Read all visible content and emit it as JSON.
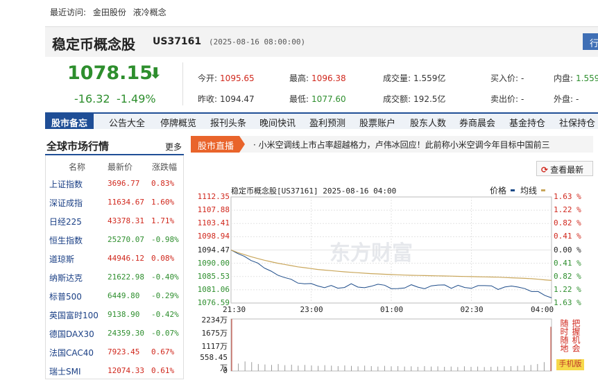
{
  "topbar": {
    "recent_label": "最近访问:",
    "recent_links": [
      "金田股份",
      "液冷概念"
    ]
  },
  "header": {
    "name": "稳定币概念股",
    "code": "US37161",
    "time": "(2025-08-16 08:00:00)",
    "trade_button": "行"
  },
  "quote": {
    "price": "1078.15",
    "arrow": "⬇",
    "change": "-16.32",
    "change_pct": "-1.49%",
    "open_label": "今开:",
    "open": "1095.65",
    "high_label": "最高:",
    "high": "1096.38",
    "volume_label": "成交量:",
    "volume": "1.559亿",
    "bid_label": "买入价:",
    "bid": "-",
    "inner_label": "内盘:",
    "inner": "1.559",
    "prev_label": "昨收:",
    "prev": "1094.47",
    "low_label": "最低:",
    "low": "1077.60",
    "amount_label": "成交额:",
    "amount": "192.5亿",
    "ask_label": "卖出价:",
    "ask": "-",
    "outer_label": "外盘:",
    "outer": "-"
  },
  "nav": {
    "active": "股市备忘",
    "items": [
      "公告大全",
      "停牌概览",
      "报刊头条",
      "晚间快讯",
      "盈利预测",
      "股票账户",
      "股东人数",
      "券商晨会",
      "基金持仓",
      "社保持仓"
    ]
  },
  "side": {
    "title": "全球市场行情",
    "more": "更多",
    "headers": [
      "名称",
      "最新价",
      "涨跌幅"
    ],
    "rows": [
      {
        "name": "上证指数",
        "price": "3696.77",
        "change": "0.83%",
        "dir": "up"
      },
      {
        "name": "深证成指",
        "price": "11634.67",
        "change": "1.60%",
        "dir": "up"
      },
      {
        "name": "日经225",
        "price": "43378.31",
        "change": "1.71%",
        "dir": "up"
      },
      {
        "name": "恒生指数",
        "price": "25270.07",
        "change": "-0.98%",
        "dir": "down"
      },
      {
        "name": "道琼斯",
        "price": "44946.12",
        "change": "0.08%",
        "dir": "up"
      },
      {
        "name": "纳斯达克",
        "price": "21622.98",
        "change": "-0.40%",
        "dir": "down"
      },
      {
        "name": "标普500",
        "price": "6449.80",
        "change": "-0.29%",
        "dir": "down"
      },
      {
        "name": "英国富时100",
        "price": "9138.90",
        "change": "-0.42%",
        "dir": "down"
      },
      {
        "name": "德国DAX30",
        "price": "24359.30",
        "change": "-0.07%",
        "dir": "down"
      },
      {
        "name": "法国CAC40",
        "price": "7923.45",
        "change": "0.67%",
        "dir": "up"
      },
      {
        "name": "瑞士SMI",
        "price": "12074.33",
        "change": "0.61%",
        "dir": "up"
      }
    ]
  },
  "live": {
    "tag": "股市直播",
    "news": "· 小米空调线上市占率超越格力，卢伟冰回应！此前称小米空调今年目标中国前三"
  },
  "refresh_label": "查看最新",
  "watermark": "东方财富",
  "mobile": {
    "lines": [
      "随时随地",
      "把握机会"
    ],
    "badge": "手机版"
  },
  "colors": {
    "up": "#d0271c",
    "down": "#2d8e2d",
    "price_line": "#1b4a88",
    "avg_line": "#c9a65a",
    "nav_active": "#1f4e96",
    "live_tag": "#e9642b"
  },
  "chart_data": {
    "type": "line",
    "title": "稳定币概念股[US37161] 2025-08-16 04:00",
    "legend": [
      "价格",
      "均线"
    ],
    "y_ticks": [
      "1112.35",
      "1107.88",
      "1103.41",
      "1098.94",
      "1094.47",
      "1090.00",
      "1085.53",
      "1081.06",
      "1076.59"
    ],
    "pct_ticks": [
      "1.63 %",
      "1.22 %",
      "0.82 %",
      "0.41 %",
      "0.00 %",
      "0.41 %",
      "0.82 %",
      "1.22 %",
      "1.63 %"
    ],
    "x_ticks": [
      "21:30",
      "23:00",
      "01:00",
      "02:30",
      "04:00"
    ],
    "ylim": [
      1076.59,
      1112.35
    ],
    "series": [
      {
        "name": "价格",
        "values": [
          1094.47,
          1093.4,
          1092.1,
          1091.2,
          1089.8,
          1088.6,
          1087.2,
          1086.0,
          1085.3,
          1084.4,
          1083.6,
          1082.8,
          1083.4,
          1082.2,
          1081.8,
          1082.6,
          1081.4,
          1082.1,
          1082.8,
          1082.2,
          1081.6,
          1082.3,
          1083.0,
          1082.4,
          1081.7,
          1081.2,
          1081.9,
          1082.6,
          1082.0,
          1081.5,
          1082.2,
          1082.9,
          1082.4,
          1081.8,
          1082.4,
          1081.9,
          1081.6,
          1082.3,
          1082.7,
          1082.1,
          1081.4,
          1081.8,
          1082.4,
          1082.0,
          1081.3,
          1080.7,
          1080.2,
          1079.4,
          1078.15
        ]
      },
      {
        "name": "均线",
        "values": [
          1094.47,
          1093.6,
          1092.9,
          1092.2,
          1091.6,
          1091.0,
          1090.5,
          1090.0,
          1089.6,
          1089.2,
          1088.8,
          1088.5,
          1088.2,
          1087.9,
          1087.7,
          1087.5,
          1087.3,
          1087.1,
          1086.95,
          1086.8,
          1086.65,
          1086.5,
          1086.4,
          1086.3,
          1086.2,
          1086.1,
          1086.0,
          1085.95,
          1085.9,
          1085.85,
          1085.8,
          1085.75,
          1085.7,
          1085.65,
          1085.6,
          1085.55,
          1085.5,
          1085.45,
          1085.4,
          1085.35,
          1085.3,
          1085.2,
          1085.1,
          1085.0,
          1084.9,
          1084.8,
          1084.6,
          1084.4,
          1084.2
        ]
      }
    ],
    "volume_ticks": [
      "2234万",
      "1675万",
      "1117万",
      "558.45万",
      "0"
    ],
    "volume_ylim": [
      0,
      2234
    ],
    "volume": [
      2234,
      320,
      410,
      380,
      300,
      280,
      260,
      300,
      250,
      270,
      230,
      260,
      240,
      220,
      250,
      230,
      210,
      240,
      220,
      200,
      230,
      210,
      190,
      220,
      200,
      210,
      190,
      200,
      180,
      210,
      190,
      200,
      180,
      190,
      170,
      200,
      180,
      190,
      170,
      180,
      190,
      200,
      210,
      220,
      240,
      260,
      300,
      380,
      1900
    ]
  }
}
